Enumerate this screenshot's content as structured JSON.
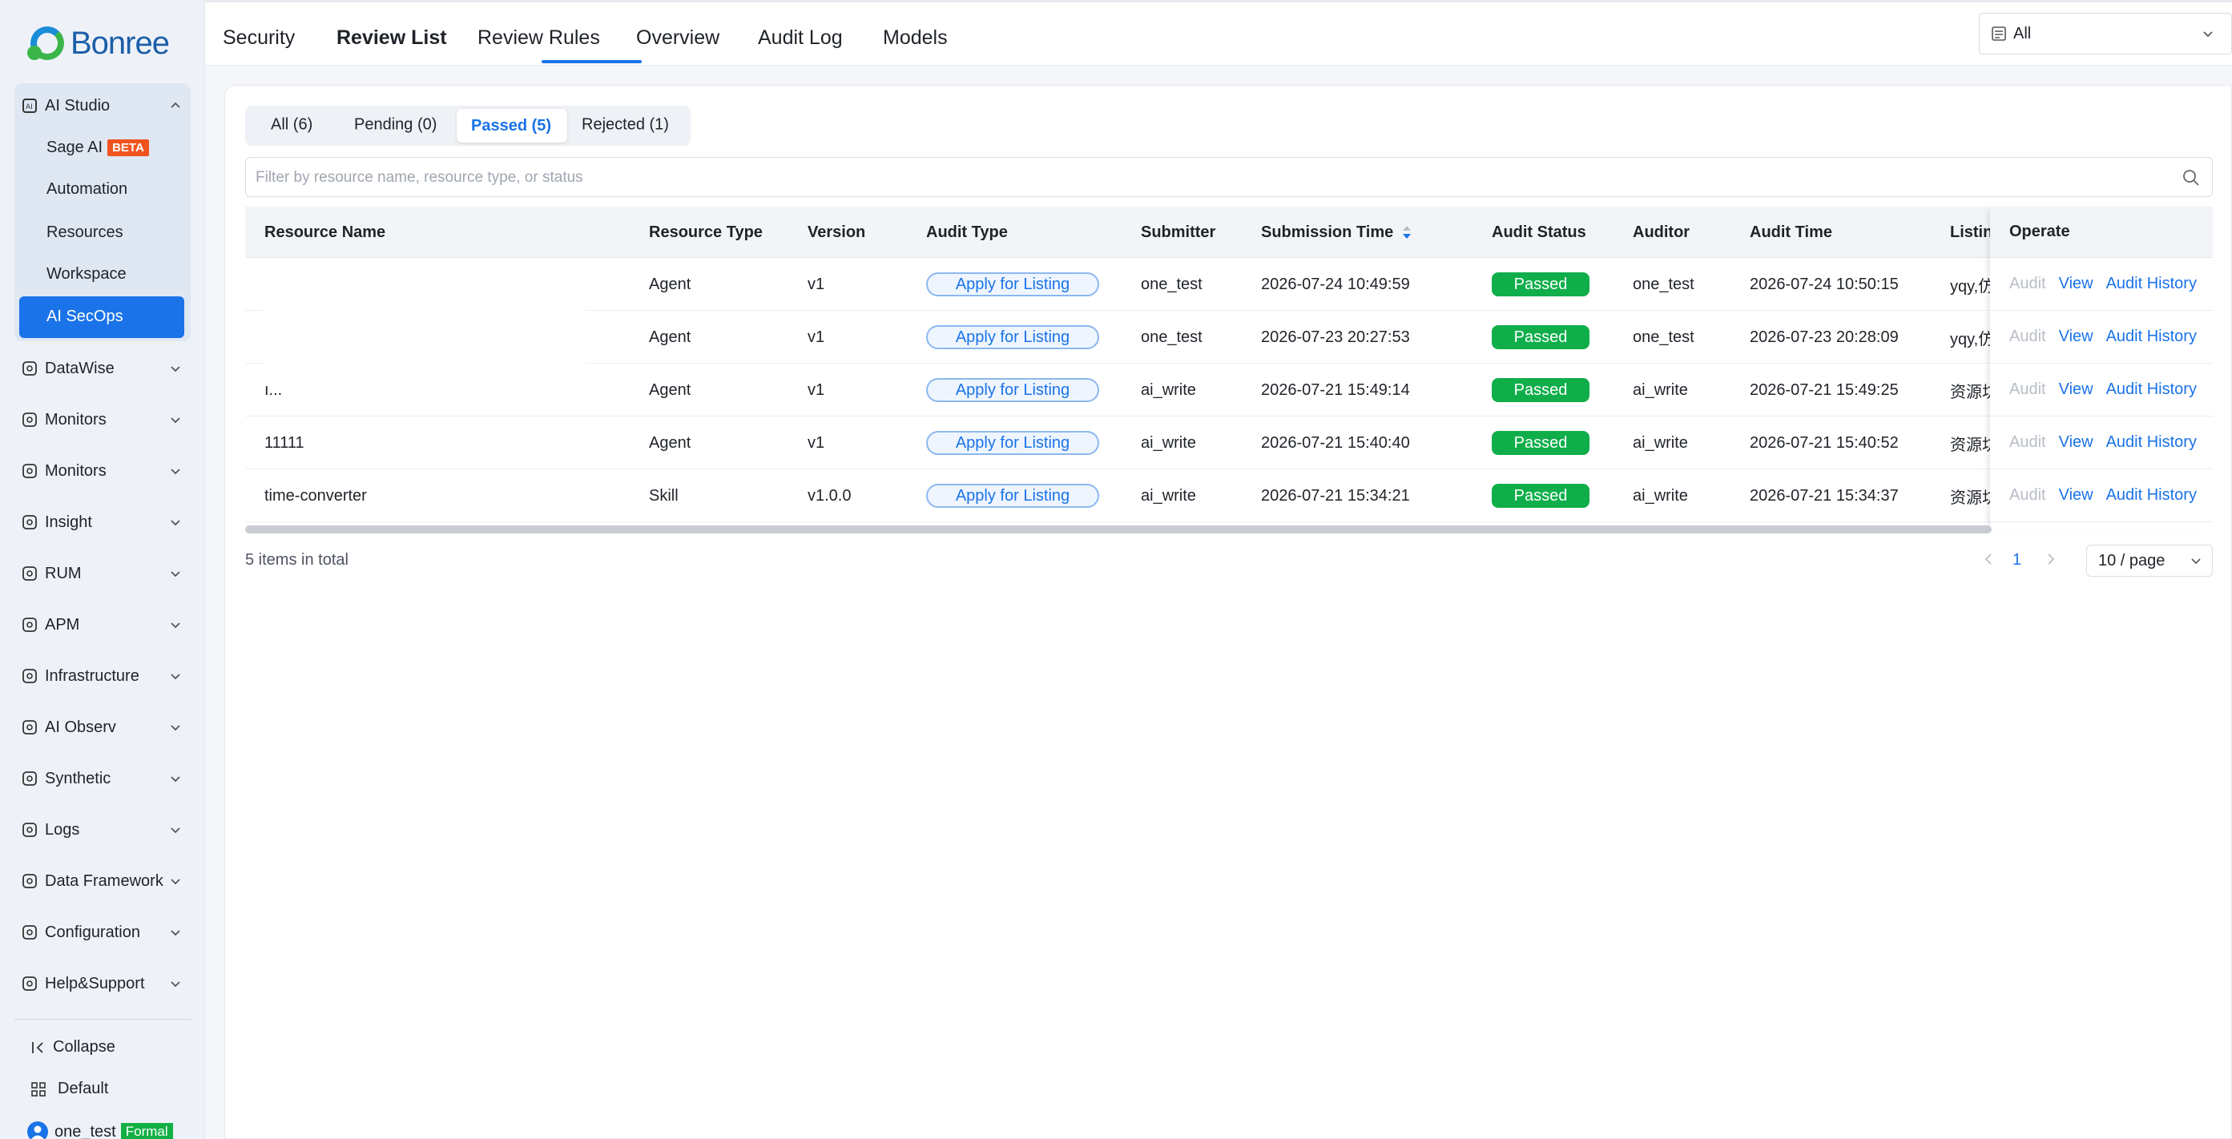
{
  "brand": {
    "logo_text": "Bonree"
  },
  "sidebar": {
    "open_group": {
      "label": "AI Studio"
    },
    "sub_items": [
      {
        "label": "Sage AI",
        "badge": "BETA"
      },
      {
        "label": "Automation"
      },
      {
        "label": "Resources"
      },
      {
        "label": "Workspace"
      },
      {
        "label": "AI SecOps",
        "active": true
      }
    ],
    "groups": [
      {
        "label": "DataWise",
        "icon": "chart-icon"
      },
      {
        "label": "Monitors",
        "icon": "monitor-icon"
      },
      {
        "label": "Monitors",
        "icon": "monitor-icon"
      },
      {
        "label": "Insight",
        "icon": "insight-icon"
      },
      {
        "label": "RUM",
        "icon": "rum-icon"
      },
      {
        "label": "APM",
        "icon": "apm-icon"
      },
      {
        "label": "Infrastructure",
        "icon": "infrastructure-icon"
      },
      {
        "label": "AI Observ",
        "icon": "ai-observ-icon"
      },
      {
        "label": "Synthetic",
        "icon": "synthetic-icon"
      },
      {
        "label": "Logs",
        "icon": "logs-icon"
      },
      {
        "label": "Data Framework",
        "icon": "data-framework-icon"
      },
      {
        "label": "Configuration",
        "icon": "configuration-icon"
      },
      {
        "label": "Help&Support",
        "icon": "help-icon"
      }
    ],
    "collapse_label": "Collapse",
    "default_label": "Default",
    "user": {
      "name": "one_test",
      "badge": "Formal"
    }
  },
  "header": {
    "tabs": [
      {
        "label": "Security"
      },
      {
        "label": "Review List",
        "active": true
      },
      {
        "label": "Review Rules"
      },
      {
        "label": "Overview"
      },
      {
        "label": "Audit Log"
      },
      {
        "label": "Models"
      }
    ],
    "workspace_select": {
      "value": "All"
    }
  },
  "filters": {
    "segments": [
      {
        "label": "All (6)"
      },
      {
        "label": "Pending (0)"
      },
      {
        "label": "Passed (5)",
        "active": true
      },
      {
        "label": "Rejected (1)"
      }
    ],
    "search_placeholder": "Filter by resource name, resource type, or status"
  },
  "table": {
    "columns": [
      "Resource Name",
      "Resource Type",
      "Version",
      "Audit Type",
      "Submitter",
      "Submission Time",
      "Audit Status",
      "Auditor",
      "Audit Time",
      "Listin",
      "Operate"
    ],
    "rows": [
      {
        "name": "",
        "type": "Agent",
        "version": "v1",
        "audit_type": "Apply for Listing",
        "submitter": "one_test",
        "submission_time": "2026-07-24 10:49:59",
        "status": "Passed",
        "auditor": "one_test",
        "audit_time": "2026-07-24 10:50:15",
        "listing": "yqy,仿"
      },
      {
        "name": "",
        "type": "Agent",
        "version": "v1",
        "audit_type": "Apply for Listing",
        "submitter": "one_test",
        "submission_time": "2026-07-23 20:27:53",
        "status": "Passed",
        "auditor": "one_test",
        "audit_time": "2026-07-23 20:28:09",
        "listing": "yqy,仿"
      },
      {
        "name": "ı...",
        "type": "Agent",
        "version": "v1",
        "audit_type": "Apply for Listing",
        "submitter": "ai_write",
        "submission_time": "2026-07-21 15:49:14",
        "status": "Passed",
        "auditor": "ai_write",
        "audit_time": "2026-07-21 15:49:25",
        "listing": "资源坊"
      },
      {
        "name": "11111",
        "type": "Agent",
        "version": "v1",
        "audit_type": "Apply for Listing",
        "submitter": "ai_write",
        "submission_time": "2026-07-21 15:40:40",
        "status": "Passed",
        "auditor": "ai_write",
        "audit_time": "2026-07-21 15:40:52",
        "listing": "资源坊"
      },
      {
        "name": "time-converter",
        "type": "Skill",
        "version": "v1.0.0",
        "audit_type": "Apply for Listing",
        "submitter": "ai_write",
        "submission_time": "2026-07-21 15:34:21",
        "status": "Passed",
        "auditor": "ai_write",
        "audit_time": "2026-07-21 15:34:37",
        "listing": "资源坊"
      }
    ],
    "operations": {
      "audit": "Audit",
      "view": "View",
      "history": "Audit History"
    }
  },
  "pagination": {
    "total_text": "5 items in total",
    "current_page": "1",
    "page_size": "10 / page"
  },
  "colors": {
    "accent": "#1a73e8",
    "passed": "#0fae4a",
    "beta": "#f0541e",
    "formal": "#12b044"
  }
}
